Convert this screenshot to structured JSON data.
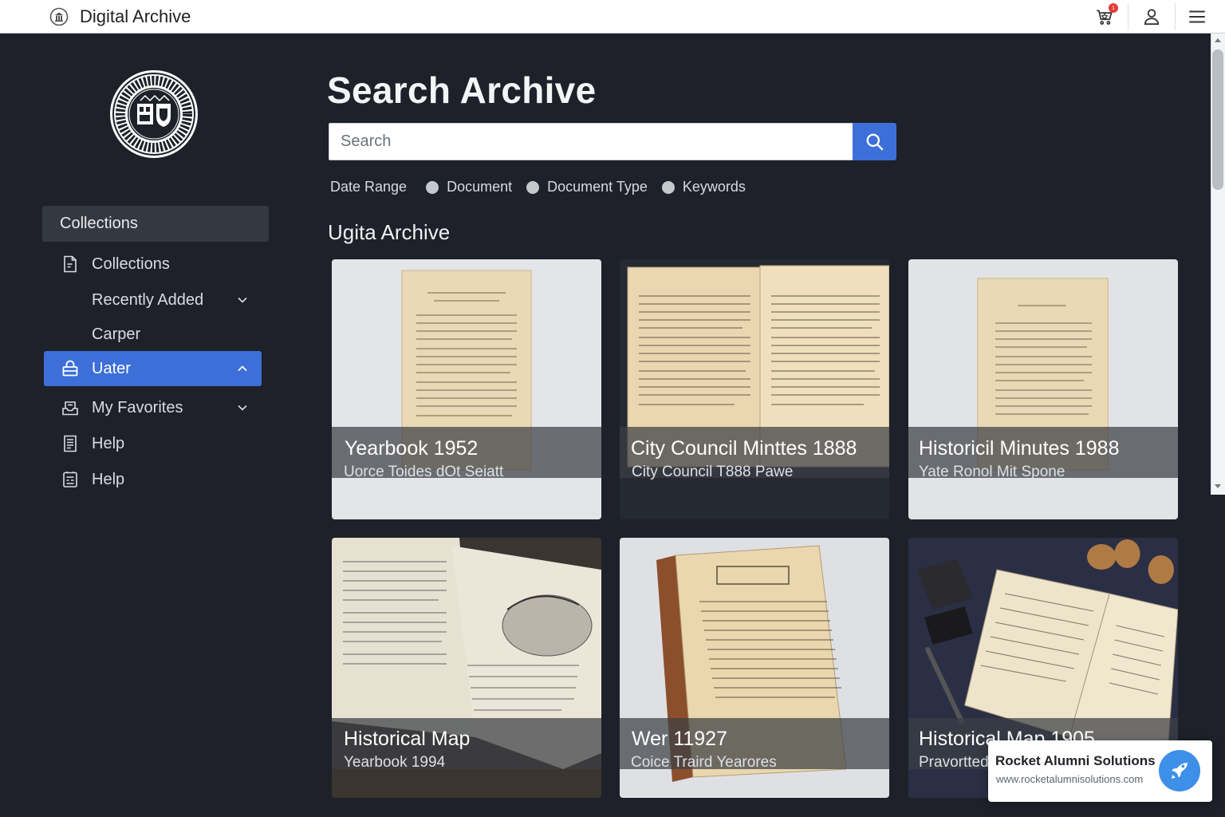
{
  "app": {
    "title": "Digital Archive"
  },
  "topbar": {
    "cart_badge": "1"
  },
  "sidebar": {
    "section_header": "Collections",
    "items": [
      {
        "label": "Collections",
        "icon": "document-icon",
        "chevron": "none"
      },
      {
        "label": "Recently Added",
        "icon": "none",
        "chevron": "down"
      },
      {
        "label": "Carper",
        "icon": "none",
        "chevron": "none"
      },
      {
        "label": "Uater",
        "icon": "lock-icon",
        "chevron": "up",
        "active": true
      },
      {
        "label": "My Favorites",
        "icon": "inbox-icon",
        "chevron": "down"
      },
      {
        "label": "Help",
        "icon": "notes-icon",
        "chevron": "none"
      },
      {
        "label": "Help",
        "icon": "form-icon",
        "chevron": "none"
      }
    ]
  },
  "main": {
    "title": "Search Archive",
    "search": {
      "placeholder": "Search",
      "value": ""
    },
    "filters": [
      "Date Range",
      "Document",
      "Document Type",
      "Keywords"
    ],
    "section_title": "Ugita Archive",
    "cards": [
      {
        "title": "Yearbook 1952",
        "subtitle": "Uorce Toides dOt Seiatt"
      },
      {
        "title": "City Council Minttes 1888",
        "subtitle": "City Council T888 Pawe"
      },
      {
        "title": "Historicil Minutes 1988",
        "subtitle": "Yate Ronol Mit Spone"
      },
      {
        "title": "Historical Map",
        "subtitle": "Yearbook 1994"
      },
      {
        "title": "Wer 11927",
        "subtitle": "Coice Traird Yearores"
      },
      {
        "title": "Historical Map 1905",
        "subtitle": "Pravortted"
      }
    ]
  },
  "toast": {
    "title": "Rocket Alumni Solutions",
    "url": "www.rocketalumnisolutions.com"
  },
  "colors": {
    "accent": "#3d6fd8",
    "background": "#1e2129",
    "badge": "#e53935"
  }
}
